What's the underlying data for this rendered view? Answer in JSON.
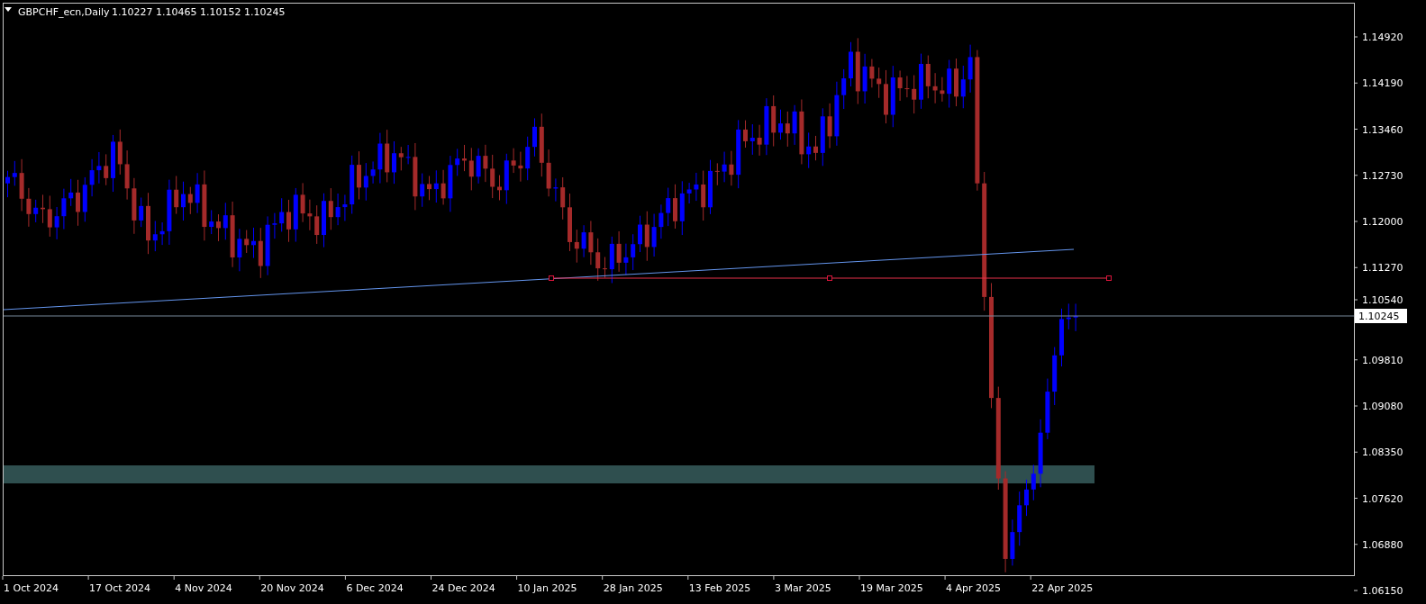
{
  "header": {
    "symbol": "GBPCHF_ecn,Daily",
    "ohlc": "1.10227 1.10465 1.10152 1.10245"
  },
  "price_axis": [
    "1.14920",
    "1.14190",
    "1.13460",
    "1.12730",
    "1.12000",
    "1.11270",
    "1.10540",
    "1.09810",
    "1.09080",
    "1.08350",
    "1.07620",
    "1.06880",
    "1.06150"
  ],
  "current_price": "1.10245",
  "date_axis": [
    "1 Oct 2024",
    "17 Oct 2024",
    "4 Nov 2024",
    "20 Nov 2024",
    "6 Dec 2024",
    "24 Dec 2024",
    "10 Jan 2025",
    "28 Jan 2025",
    "13 Feb 2025",
    "3 Mar 2025",
    "19 Mar 2025",
    "4 Apr 2025",
    "22 Apr 2025"
  ]
}
